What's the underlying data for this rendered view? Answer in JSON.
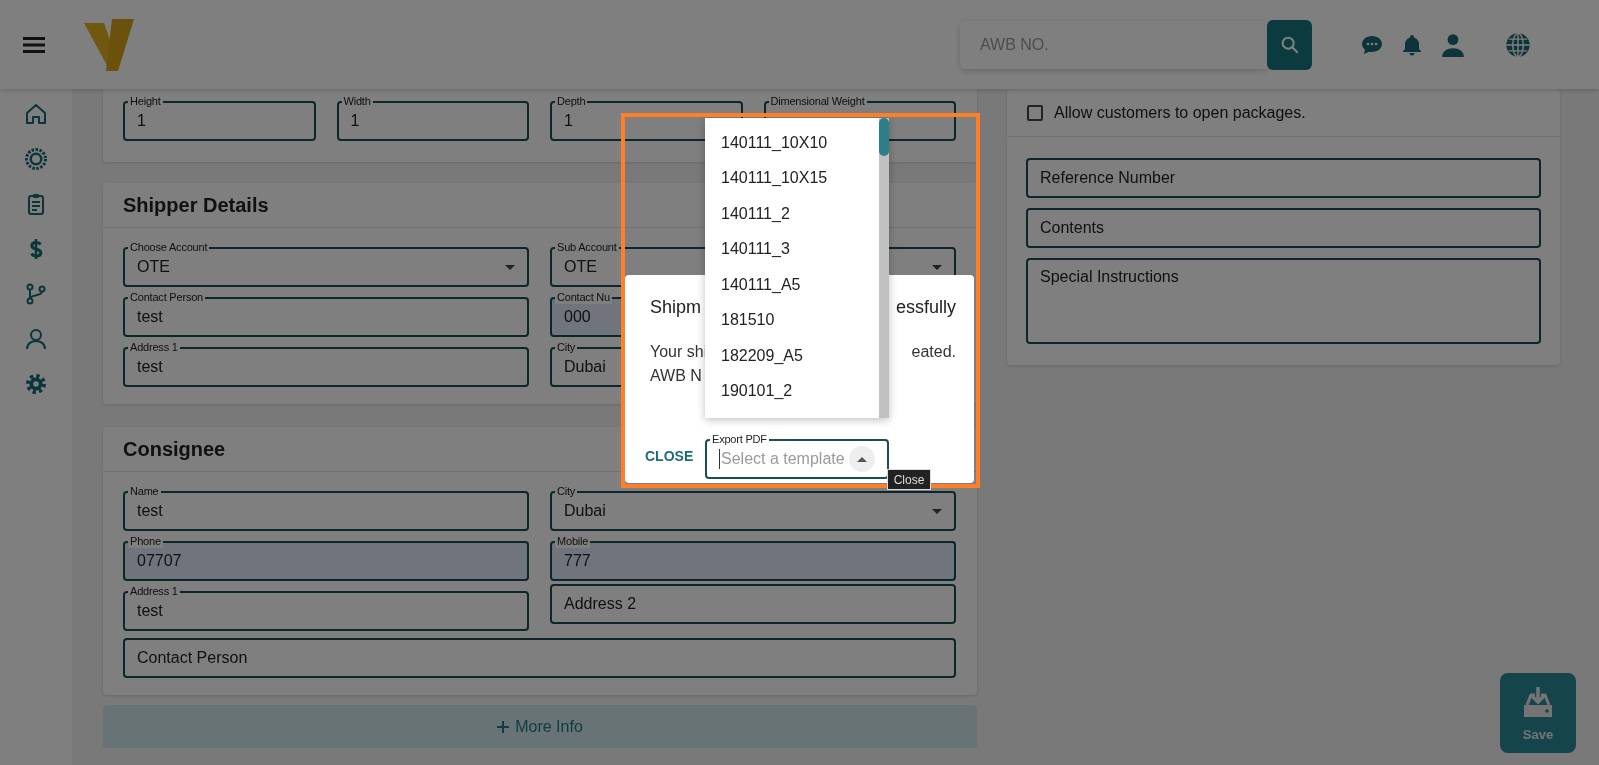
{
  "header": {
    "search": {
      "placeholder": "AWB NO."
    }
  },
  "dimensions": {
    "fields": [
      {
        "label": "Height",
        "value": "1",
        "kind": "input",
        "autofilled": false
      },
      {
        "label": "Width",
        "value": "1",
        "kind": "input",
        "autofilled": false
      },
      {
        "label": "Depth",
        "value": "1",
        "kind": "input",
        "autofilled": false
      },
      {
        "label": "Dimensional Weight",
        "kind": "input",
        "autofilled": false
      }
    ]
  },
  "shipper": {
    "title": "Shipper Details",
    "fields": [
      {
        "label": "Choose Account",
        "value": "OTE",
        "kind": "select",
        "autofilled": false
      },
      {
        "label": "Sub Account",
        "value": "OTE",
        "kind": "select",
        "autofilled": false
      },
      {
        "label": "Contact Person",
        "value": "test",
        "kind": "input",
        "autofilled": false
      },
      {
        "label": "Contact Nu",
        "value": "000",
        "kind": "input",
        "autofilled": true
      },
      {
        "label": "Address 1",
        "value": "test",
        "kind": "input",
        "autofilled": false
      },
      {
        "label": "City",
        "value": "Dubai",
        "kind": "input",
        "autofilled": false
      }
    ]
  },
  "consignee": {
    "title": "Consignee",
    "fields": [
      {
        "label": "Name",
        "value": "test",
        "kind": "input",
        "autofilled": false
      },
      {
        "label": "City",
        "value": "Dubai",
        "kind": "select",
        "autofilled": false
      },
      {
        "label": "Phone",
        "value": "07707",
        "kind": "input",
        "autofilled": true
      },
      {
        "label": "Mobile",
        "value": "777",
        "kind": "input",
        "autofilled": true
      },
      {
        "label": "Address 1",
        "value": "test",
        "kind": "input",
        "autofilled": false
      },
      {
        "placeholder": "Address 2",
        "kind": "input",
        "autofilled": false
      },
      {
        "placeholder": "Contact Person",
        "kind": "wide",
        "autofilled": false
      }
    ]
  },
  "more_info_button": {
    "label": "More Info"
  },
  "options": {
    "allow_open_packages": {
      "label": "Allow customers to open packages.",
      "checked": false
    },
    "fields": [
      {
        "placeholder": "Reference Number",
        "kind": "input",
        "autofilled": false
      },
      {
        "placeholder": "Contents",
        "kind": "input",
        "autofilled": false
      },
      {
        "placeholder": "Special Instructions",
        "kind": "textarea",
        "autofilled": false
      }
    ]
  },
  "save_button": {
    "label": "Save"
  },
  "dialog": {
    "title_start": "Shipm",
    "title_end": "essfully",
    "message_start": "Your shi",
    "message_end": "eated.",
    "message_line2": "AWB N",
    "close_button": "CLOSE",
    "export_field": {
      "label": "Export PDF",
      "placeholder": "Select a template"
    },
    "tooltip": "Close"
  },
  "template_menu": {
    "items": [
      {
        "label": "140111_10X10",
        "selected": false
      },
      {
        "label": "140111_10X15",
        "selected": false
      },
      {
        "label": "140111_2",
        "selected": false
      },
      {
        "label": "140111_3",
        "selected": false
      },
      {
        "label": "140111_A5",
        "selected": false
      },
      {
        "label": "181510",
        "selected": false
      },
      {
        "label": "182209_A5",
        "selected": false
      },
      {
        "label": "190101_2",
        "selected": false
      }
    ]
  }
}
